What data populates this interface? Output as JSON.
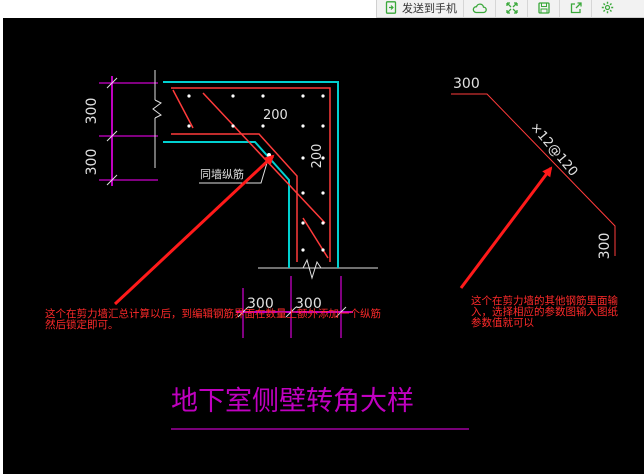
{
  "toolbar": {
    "send_to_phone_label": "发送到手机",
    "icons": [
      "send-phone-icon",
      "cloud-icon",
      "expand-icon",
      "save-icon",
      "share-icon",
      "settings-icon"
    ],
    "icon_color": "#3aa83a"
  },
  "drawing": {
    "background": "#000000",
    "dims": {
      "left_top": "300",
      "left_bottom": "300",
      "inner_h": "200",
      "inner_v": "200",
      "bottom_left": "300",
      "bottom_right": "300",
      "right_top": "300",
      "right_side": "300"
    },
    "labels": {
      "wall_rebar": "同墙纵筋",
      "rebar_spec": "×12@120",
      "title": "地下室侧壁转角大样"
    },
    "notes": {
      "left": "这个在剪力墙汇总计算以后，到编辑钢筋界面在数量上额外添加一个纵筋\n然后锁定即可。",
      "right": "这个在剪力墙的其他钢筋里面输\n入，选择相应的参数图输入图纸\n参数值就可以"
    },
    "colors": {
      "wall": "#00d0d0",
      "rebar": "#ff3b3b",
      "dim": "#ff00ff",
      "dim_text": "#e0e0e0",
      "arrow": "#ff1a1a",
      "title": "#c000c0"
    }
  }
}
